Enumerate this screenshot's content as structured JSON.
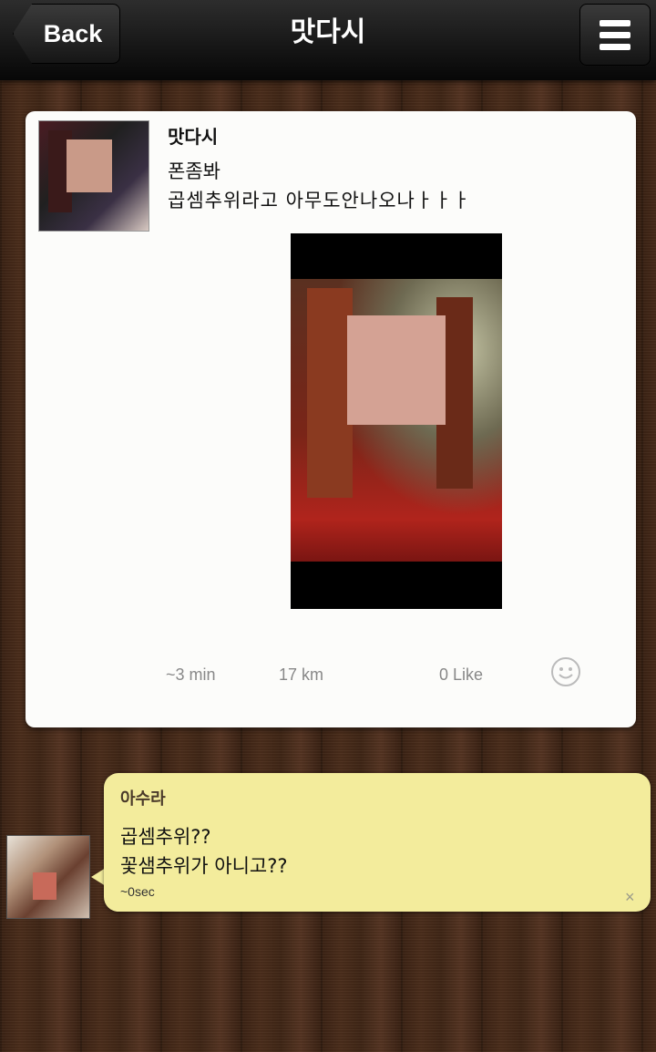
{
  "header": {
    "back_label": "Back",
    "title": "맛다시"
  },
  "post": {
    "author": "맛다시",
    "text_line1": "폰좀봐",
    "text_line2": "곱셈추위라고 아무도안나오나ㅏㅏㅏ",
    "time": "~3 min",
    "distance": "17 km",
    "likes": "0 Like"
  },
  "reply": {
    "author": "아수라",
    "text_line1": "곱셈추위??",
    "text_line2": "꽃샘추위가 아니고??",
    "time": "~0sec",
    "close": "×"
  },
  "icons": {
    "menu": "menu-icon",
    "smiley": "smiley-icon",
    "close": "close-icon"
  },
  "colors": {
    "card_bg": "#fcfcfa",
    "reply_bg": "#f3ec9c",
    "bar_bg": "#121212"
  }
}
